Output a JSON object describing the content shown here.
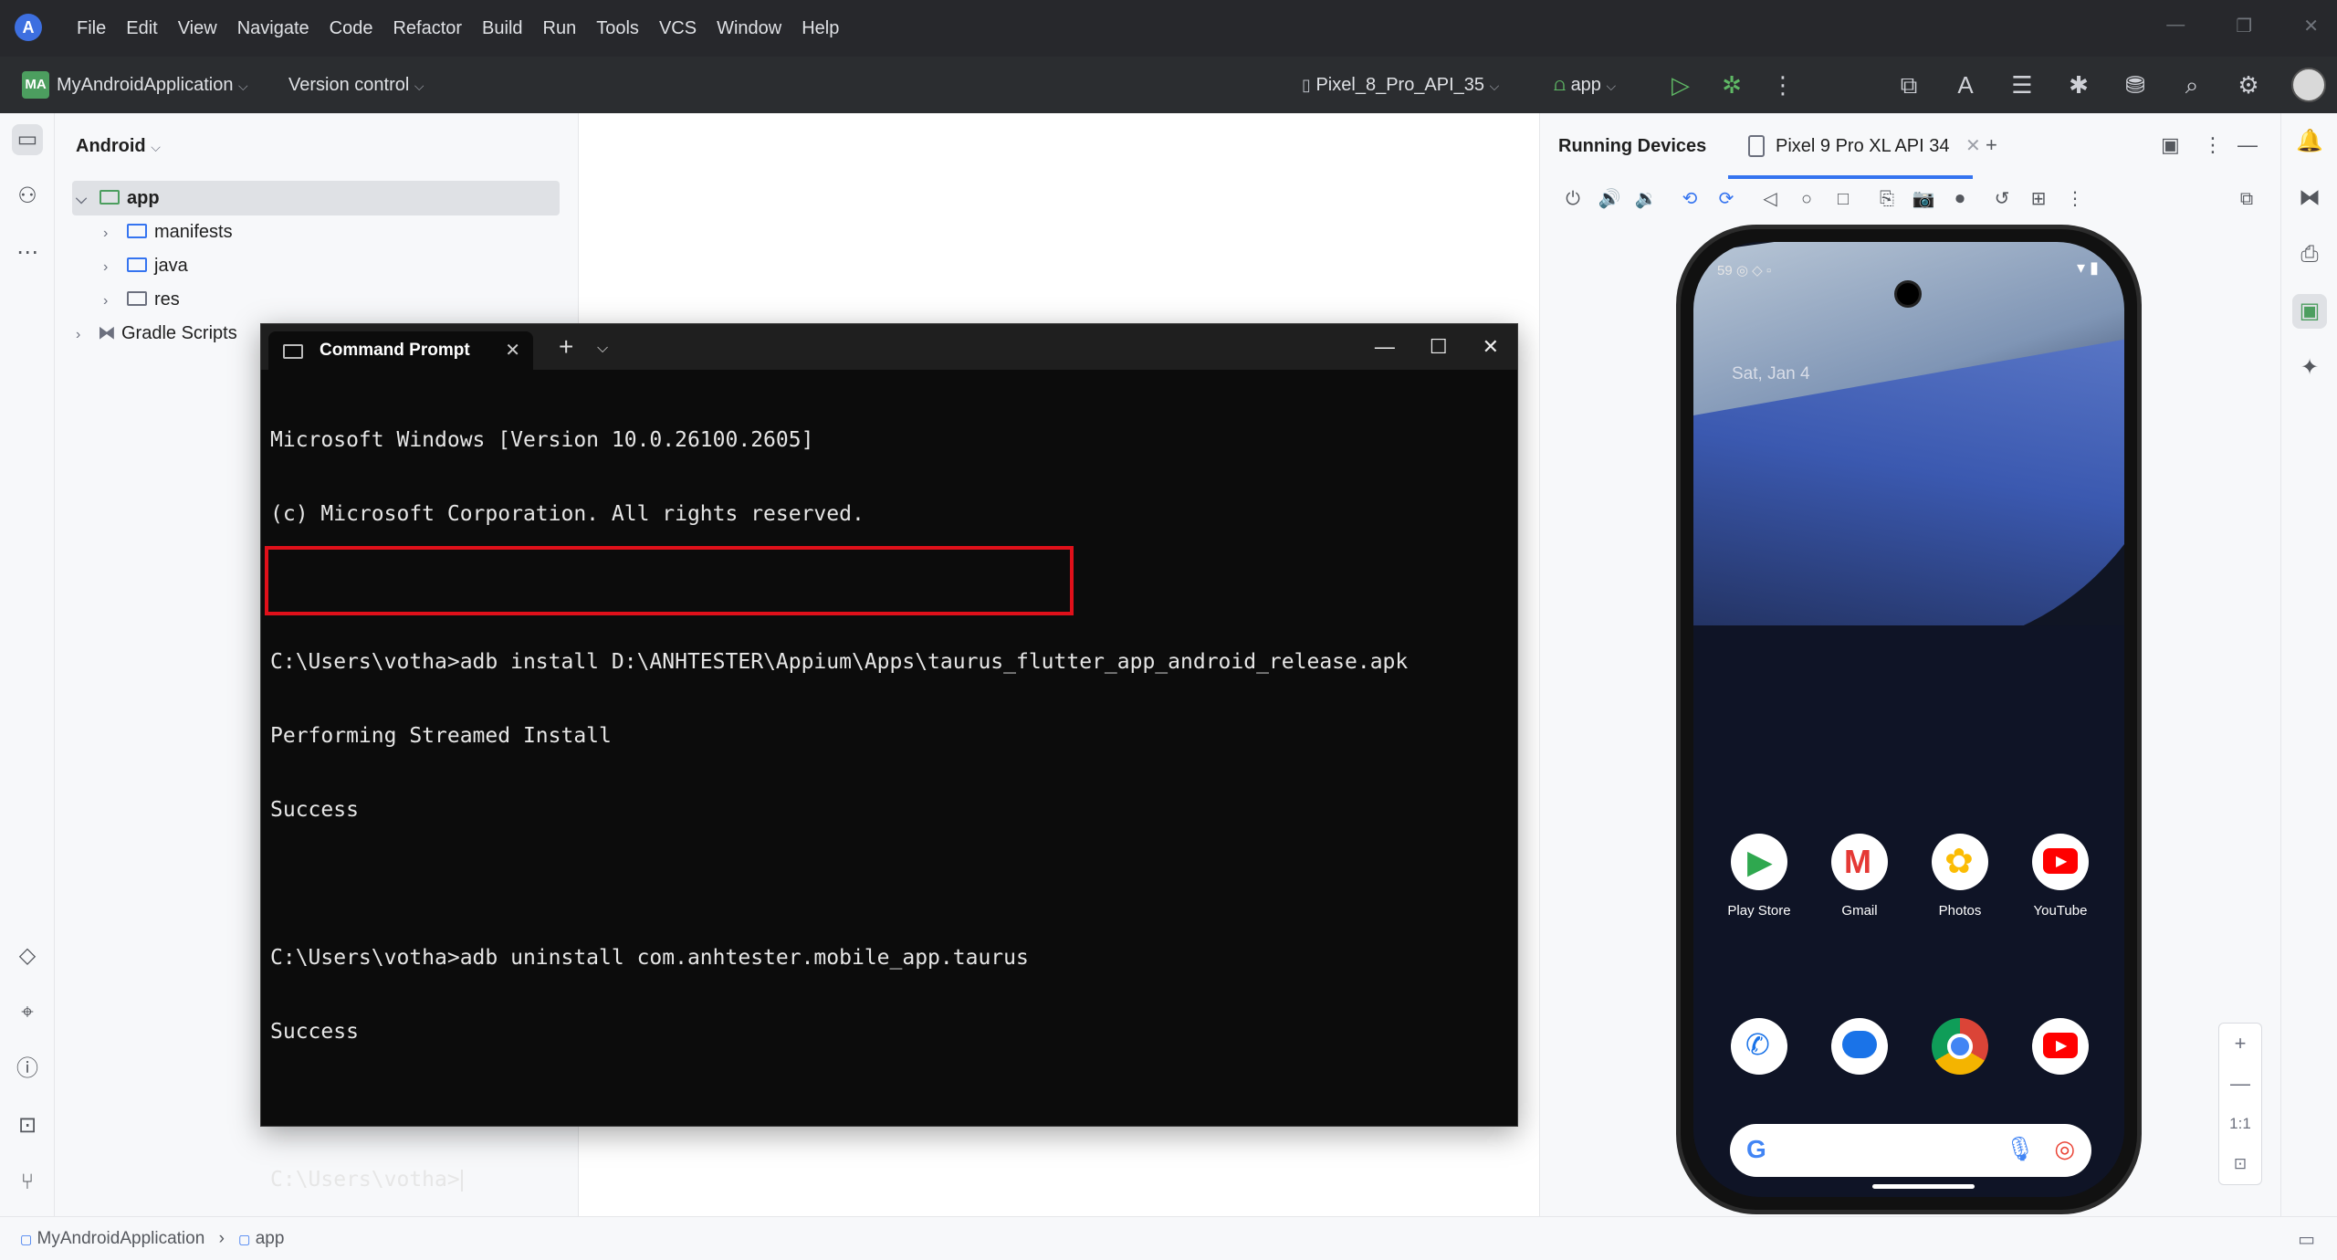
{
  "menubar": {
    "logo": "A",
    "items": [
      "File",
      "Edit",
      "View",
      "Navigate",
      "Code",
      "Refactor",
      "Build",
      "Run",
      "Tools",
      "VCS",
      "Window",
      "Help"
    ]
  },
  "toolbar": {
    "project_badge": "MA",
    "project_name": "MyAndroidApplication",
    "version_control": "Version control",
    "device": "Pixel_8_Pro_API_35",
    "run_config": "app"
  },
  "project": {
    "view_title": "Android",
    "tree": [
      {
        "label": "app",
        "level": 0,
        "expanded": true
      },
      {
        "label": "manifests",
        "level": 1
      },
      {
        "label": "java",
        "level": 1
      },
      {
        "label": "res",
        "level": 1
      },
      {
        "label": "Gradle Scripts",
        "level": 0
      }
    ]
  },
  "terminal": {
    "tab_title": "Command Prompt",
    "lines": [
      "Microsoft Windows [Version 10.0.26100.2605]",
      "(c) Microsoft Corporation. All rights reserved.",
      "",
      "C:\\Users\\votha>adb install D:\\ANHTESTER\\Appium\\Apps\\taurus_flutter_app_android_release.apk",
      "Performing Streamed Install",
      "Success",
      "",
      "C:\\Users\\votha>adb uninstall com.anhtester.mobile_app.taurus",
      "Success",
      ""
    ],
    "prompt": "C:\\Users\\votha>"
  },
  "running_devices": {
    "title": "Running Devices",
    "device_tab": "Pixel 9 Pro XL API 34"
  },
  "phone": {
    "date": "Sat, Jan 4",
    "status_left": "59",
    "apps_row1": [
      "Play Store",
      "Gmail",
      "Photos",
      "YouTube"
    ]
  },
  "zoom": {
    "ratio": "1:1"
  },
  "statusbar": {
    "crumbs": [
      "MyAndroidApplication",
      "app"
    ]
  },
  "colors": {
    "accent": "#3574f0",
    "highlight": "#e0101a",
    "run_green": "#5fb865"
  }
}
